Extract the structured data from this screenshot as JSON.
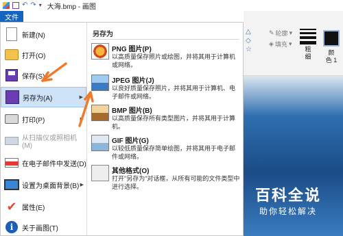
{
  "window": {
    "title": "大海.bmp - 画图"
  },
  "file_tab": {
    "label": "文件"
  },
  "ribbon": {
    "outline_label": "轮廓",
    "fill_label": "填充",
    "width_label": "粗\n细",
    "color1_label": "颜\n色 1"
  },
  "menu": {
    "items": [
      {
        "label": "新建(N)"
      },
      {
        "label": "打开(O)"
      },
      {
        "label": "保存(S)"
      },
      {
        "label": "另存为(A)"
      },
      {
        "label": "打印(P)"
      },
      {
        "label": "从扫描仪或照相机(M)"
      },
      {
        "label": "在电子邮件中发送(D)"
      },
      {
        "label": "设置为桌面背景(B)"
      },
      {
        "label": "属性(E)"
      },
      {
        "label": "关于画图(T)"
      }
    ]
  },
  "saveas": {
    "heading": "另存为",
    "options": [
      {
        "title": "PNG 图片(P)",
        "desc": "以高质量保存照片或绘图，并将其用于计算机或网络。"
      },
      {
        "title": "JPEG 图片(J)",
        "desc": "以良好质量保存照片，并将其用于计算机、电子邮件或网络。"
      },
      {
        "title": "BMP 图片(B)",
        "desc": "以高质量保存所有类型图片，并将其用于计算机。"
      },
      {
        "title": "GIF 图片(G)",
        "desc": "以较低质量保存简单绘图，并将其用于电子邮件或网络。"
      },
      {
        "title": "其他格式(O)",
        "desc": "打开\"另存为\"对话框，从所有可能的文件类型中进行选择。"
      }
    ]
  },
  "watermark": {
    "title": "百科全说",
    "subtitle": "助你轻松解决"
  },
  "colors": {
    "file_tab": "#1565c0",
    "highlight": "#cfe3f8",
    "annotation_arrow": "#f07a2a"
  }
}
